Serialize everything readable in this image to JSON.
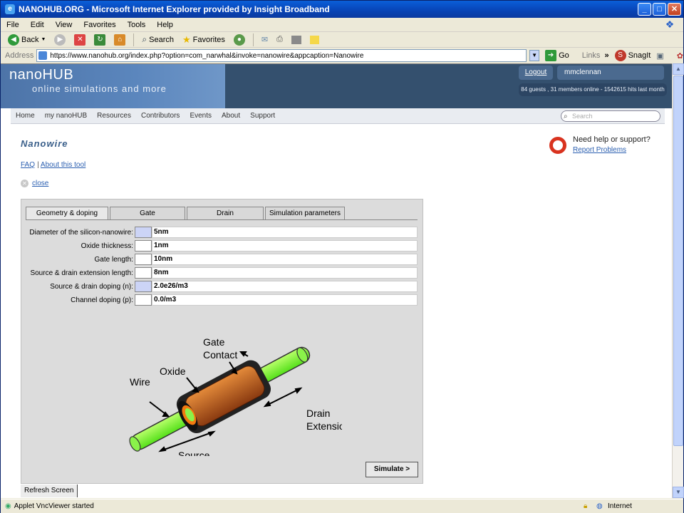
{
  "window": {
    "title": "NANOHUB.ORG - Microsoft Internet Explorer provided by Insight Broadband"
  },
  "menu": [
    "File",
    "Edit",
    "View",
    "Favorites",
    "Tools",
    "Help"
  ],
  "toolbar": {
    "back": "Back",
    "search": "Search",
    "favorites": "Favorites"
  },
  "address": {
    "label": "Address",
    "url": "https://www.nanohub.org/index.php?option=com_narwhal&invoke=nanowire&appcaption=Nanowire",
    "go": "Go",
    "links": "Links",
    "snagit": "SnagIt"
  },
  "header": {
    "logo": "nanoHUB",
    "tagline": "online simulations and more",
    "logout": "Logout",
    "user": "mmclennan",
    "stats": "84 guests , 31 members online - 1542615 hits last month"
  },
  "nav": [
    "Home",
    "my nanoHUB",
    "Resources",
    "Contributors",
    "Events",
    "About",
    "Support"
  ],
  "search": {
    "placeholder": "Search"
  },
  "page": {
    "title": "Nanowire",
    "faq": "FAQ",
    "about": "About this tool",
    "close": "close",
    "help_title": "Need help or support?",
    "help_link": "Report Problems"
  },
  "applet": {
    "tabs": [
      "Geometry & doping",
      "Gate",
      "Drain",
      "Simulation parameters"
    ],
    "fields": [
      {
        "label": "Diameter of the silicon-nanowire:",
        "value": "5nm"
      },
      {
        "label": "Oxide thickness:",
        "value": "1nm"
      },
      {
        "label": "Gate length:",
        "value": "10nm"
      },
      {
        "label": "Source & drain extension length:",
        "value": "8nm"
      },
      {
        "label": "Source & drain doping (n):",
        "value": "2.0e26/m3"
      },
      {
        "label": "Channel doping (p):",
        "value": "0.0/m3"
      }
    ],
    "diagram": {
      "gate_contact_1": "Gate",
      "gate_contact_2": "Contact",
      "oxide": "Oxide",
      "wire": "Wire",
      "drain_1": "Drain",
      "drain_2": "Extension",
      "source": "Source"
    },
    "simulate": "Simulate >",
    "refresh": "Refresh Screen"
  },
  "status": {
    "text": "Applet VncViewer started",
    "zone": "Internet"
  }
}
